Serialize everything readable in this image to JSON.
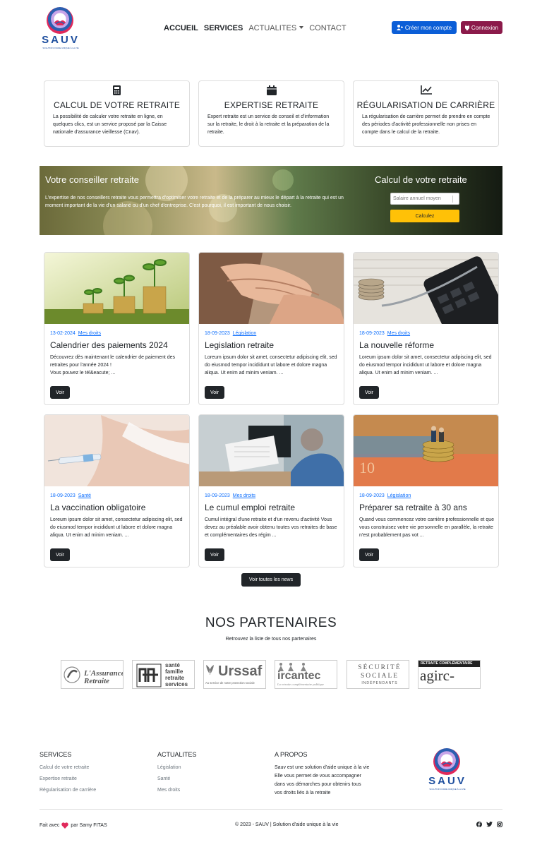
{
  "brand": {
    "name": "SAUV",
    "tagline": "SOLUTION D'AIDE UNIQUE À LA VIE"
  },
  "nav": {
    "items": [
      {
        "label": "ACCUEIL"
      },
      {
        "label": "SERVICES"
      },
      {
        "label": "ACTUALITES"
      },
      {
        "label": "CONTACT"
      }
    ],
    "create_account": "Créer mon compte",
    "login": "Connexion"
  },
  "services": [
    {
      "icon": "calculator-icon",
      "title": "CALCUL DE VOTRE RETRAITE",
      "text": "La possibilité de calculer votre retraite en ligne, en quelques clics, est un service proposé par la Caisse nationale d'assurance vieillesse (Cnav)."
    },
    {
      "icon": "calendar-icon",
      "title": "EXPERTISE RETRAITE",
      "text": "Expert retraite est un service de conseil et d'information sur la retraite, le droit à la retraite et la préparation de la retraite."
    },
    {
      "icon": "chart-line-icon",
      "title": "RÉGULARISATION DE CARRIÈRE",
      "text": "La régularisation de carrière permet de prendre en compte des périodes d'activité professionnelle non prises en compte dans le calcul de la retraite."
    }
  ],
  "banner": {
    "title": "Votre conseiller retraite",
    "text": "L'expertise de nos conseillers retraite vous permettra d'optimiser votre retraite et de la préparer au mieux le départ à la retraite qui est un moment important de la vie d'un salarié ou d'un chef d'entreprise. C'est pourquoi, il est important de nous choisir.",
    "calc_title": "Calcul de votre retraite",
    "salary_placeholder": "Salaire annuel moyen",
    "calc_button": "Calculez"
  },
  "news": [
    {
      "date": "13-02-2024",
      "category": "Mes droits",
      "title": "Calendrier des paiements 2024",
      "text": "Découvrez dès maintenant le calendrier de paiement des retraites pour l'année 2024 !\nVous pouvez le tél&eacute; ...",
      "button": "Voir"
    },
    {
      "date": "18-09-2023",
      "category": "Législation",
      "title": "Legislation retraite",
      "text": "Loreum ipsum dolor sit amet, consectetur adipiscing elit, sed do eiusmod tempor incididunt ut labore et dolore magna aliqua. Ut enim ad minim veniam. ...",
      "button": "Voir"
    },
    {
      "date": "18-09-2023",
      "category": "Mes droits",
      "title": "La nouvelle réforme",
      "text": "Loreum ipsum dolor sit amet, consectetur adipiscing elit, sed do eiusmod tempor incididunt ut labore et dolore magna aliqua. Ut enim ad minim veniam. ...",
      "button": "Voir"
    },
    {
      "date": "18-09-2023",
      "category": "Santé",
      "title": "La vaccination obligatoire",
      "text": "Loreum ipsum dolor sit amet, consectetur adipiscing elit, sed do eiusmod tempor incididunt ut labore et dolore magna aliqua. Ut enim ad minim veniam. ...",
      "button": "Voir"
    },
    {
      "date": "18-09-2023",
      "category": "Mes droits",
      "title": "Le cumul emploi retraite",
      "text": "Cumul intégral d'une retraite et d'un revenu d'activité Vous devez au préalable avoir obtenu toutes vos retraites de base et complémentaires des régim ...",
      "button": "Voir"
    },
    {
      "date": "18-09-2023",
      "category": "Législation",
      "title": "Préparer sa retraite à 30 ans",
      "text": "Quand vous commencez votre carrière professionnelle et que vous construisez votre vie personnelle en parallèle, la retraite n'est probablement pas vot ...",
      "button": "Voir"
    }
  ],
  "all_news_button": "Voir toutes les news",
  "partners": {
    "title": "NOS PARTENAIRES",
    "subtitle": "Retrouvez la liste de tous nos partenaires",
    "logos": [
      {
        "name": "L'Assurance Retraite"
      },
      {
        "name": "santé famille retraite services"
      },
      {
        "name": "Urssaf",
        "sub": "Au service de notre protection sociale"
      },
      {
        "name": "ircantec",
        "sub": "La retraite complémentaire publique"
      },
      {
        "name": "SÉCURITÉ SOCIALE",
        "sub": "INDÉPENDANTS"
      },
      {
        "name": "agirc-arrco",
        "sub": "RETRAITE COMPLÉMENTAIRE"
      }
    ]
  },
  "footer": {
    "services_title": "SERVICES",
    "services_links": [
      "Calcul de votre retraite",
      "Expertise retraite",
      "Régularisation de carrière"
    ],
    "news_title": "ACTUALITES",
    "news_links": [
      "Législation",
      "Santé",
      "Mes droits"
    ],
    "about_title": "A PROPOS",
    "about_lines": [
      "Sauv est une solution d'aide unique à la vie",
      "Elle vous permet de vous accompagner",
      "dans vos démarches pour obtenirs tous",
      "vos droits liés à la retraite"
    ],
    "made_with": "Fait avec",
    "by": "par Samy FITAS",
    "copyright": "© 2023 - SAUV | Solution d'aide unique à la vie"
  }
}
